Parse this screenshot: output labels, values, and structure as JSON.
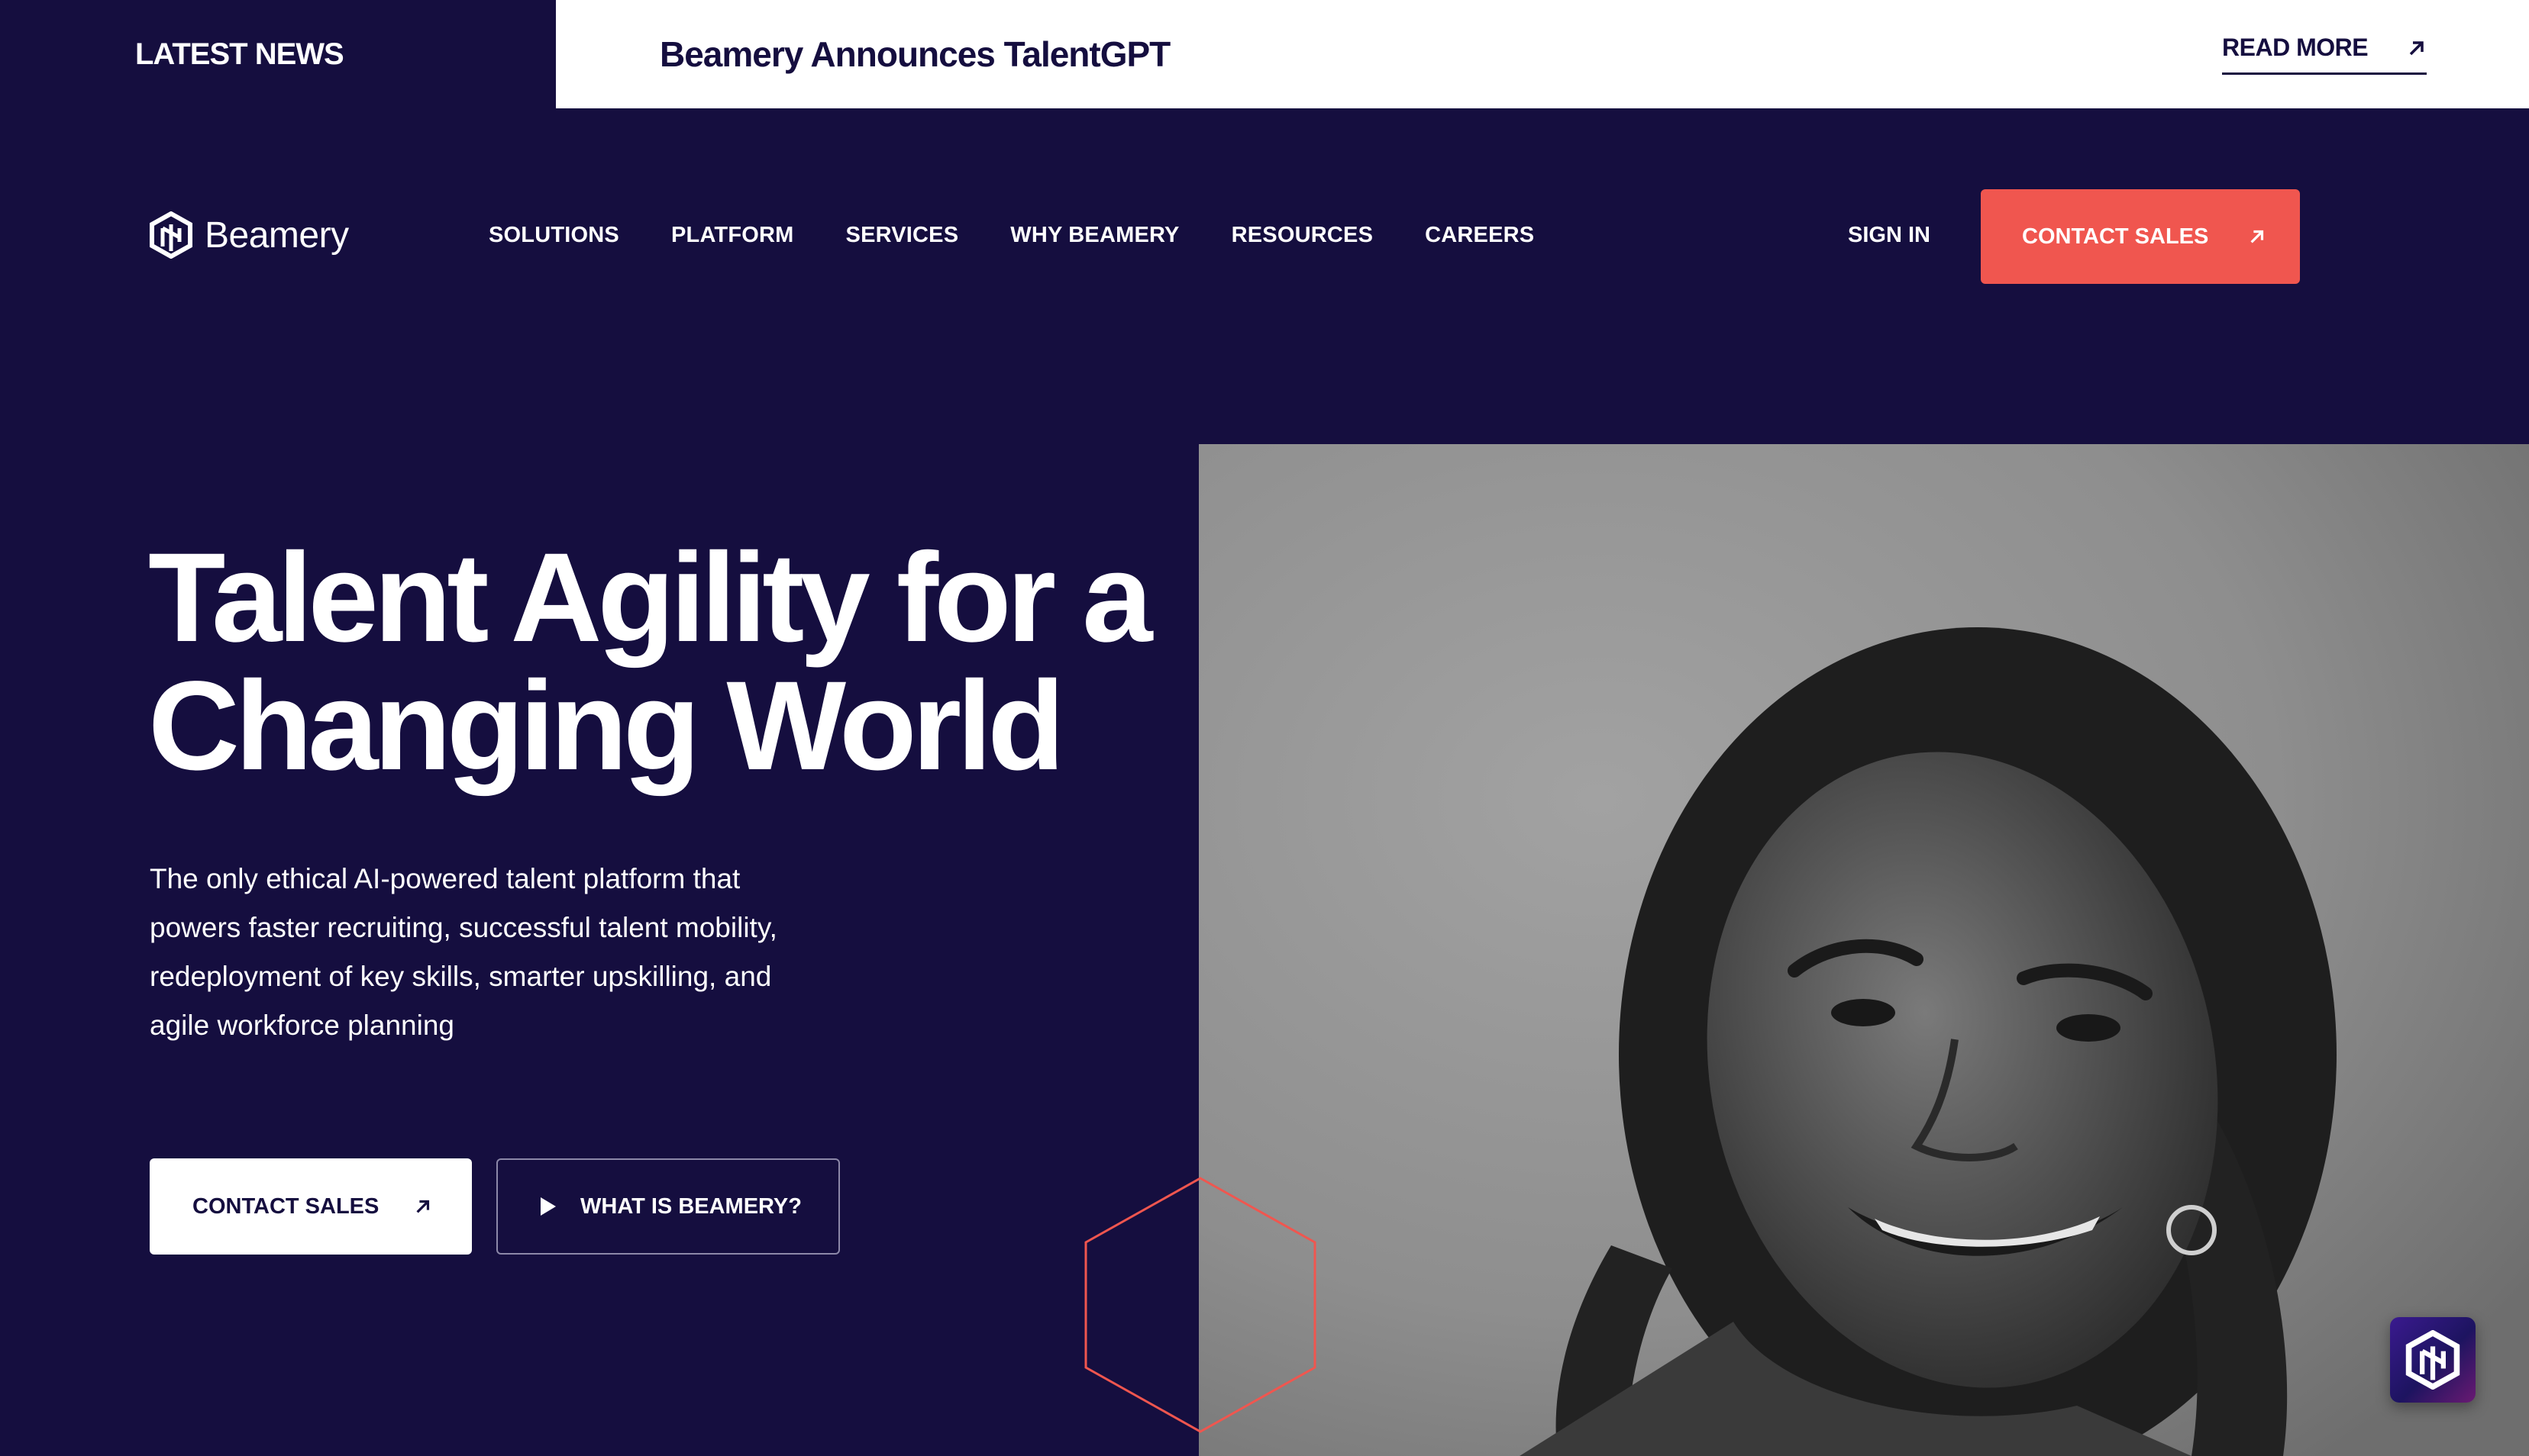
{
  "news": {
    "label": "LATEST NEWS",
    "title": "Beamery Announces TalentGPT",
    "read_more": "READ MORE"
  },
  "brand": {
    "name": "Beamery"
  },
  "nav": {
    "items": [
      "SOLUTIONS",
      "PLATFORM",
      "SERVICES",
      "WHY BEAMERY",
      "RESOURCES",
      "CAREERS"
    ],
    "sign_in": "SIGN IN",
    "contact_sales": "CONTACT SALES"
  },
  "hero": {
    "headline_line1": "Talent Agility for a",
    "headline_line2": "Changing World",
    "subtext": "The only ethical AI-powered talent platform that powers faster recruiting, successful talent mobility, redeployment of key skills, smarter upskilling, and agile workforce planning",
    "cta_primary": "CONTACT SALES",
    "cta_secondary": "WHAT IS BEAMERY?"
  },
  "icons": {
    "arrow": "arrow-up-right-icon",
    "play": "play-icon",
    "logo": "beamery-logo-icon",
    "chat": "chat-widget-icon",
    "hexagon": "hexagon-outline"
  },
  "colors": {
    "background": "#150e3f",
    "accent": "#f0564f",
    "white": "#ffffff"
  }
}
